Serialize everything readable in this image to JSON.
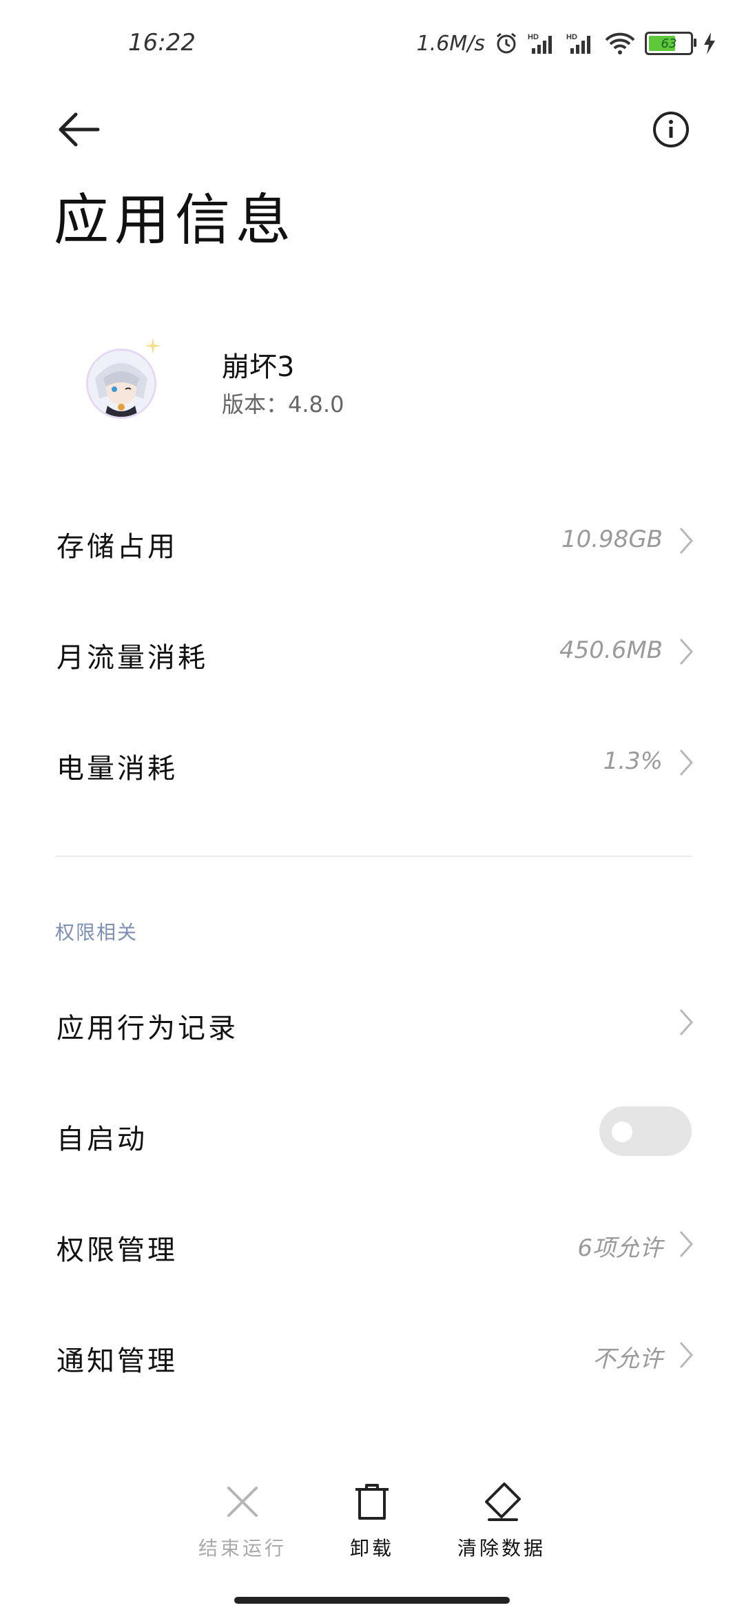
{
  "status_bar": {
    "time": "16:22",
    "net_speed": "1.6M/s",
    "alarm_icon": "alarm-clock-icon",
    "signal_icons": [
      "hd-signal-icon",
      "hd-signal-icon"
    ],
    "wifi_icon": "wifi-icon",
    "battery_level": "63",
    "charging_icon": "lightning-icon"
  },
  "toolbar": {
    "back_icon": "arrow-left-icon",
    "info_icon": "info-circle-icon"
  },
  "page_title": "应用信息",
  "app": {
    "name": "崩坏3",
    "version": "版本：4.8.0"
  },
  "usage_rows": [
    {
      "label": "存储占用",
      "value": "10.98GB"
    },
    {
      "label": "月流量消耗",
      "value": "450.6MB"
    },
    {
      "label": "电量消耗",
      "value": "1.3%"
    }
  ],
  "permissions_section": {
    "title": "权限相关",
    "rows": [
      {
        "label": "应用行为记录",
        "value": ""
      },
      {
        "label": "自启动",
        "toggle_on": false
      },
      {
        "label": "权限管理",
        "value": "6项允许"
      },
      {
        "label": "通知管理",
        "value": "不允许"
      }
    ]
  },
  "bottom_actions": [
    {
      "label": "结束运行",
      "icon": "close-x-icon",
      "enabled": false
    },
    {
      "label": "卸载",
      "icon": "trash-icon",
      "enabled": true
    },
    {
      "label": "清除数据",
      "icon": "eraser-icon",
      "enabled": true
    }
  ],
  "colors": {
    "accent_section": "#7d8fb5",
    "value_gray": "#9a9a9a",
    "battery_green": "#5cc83a"
  }
}
